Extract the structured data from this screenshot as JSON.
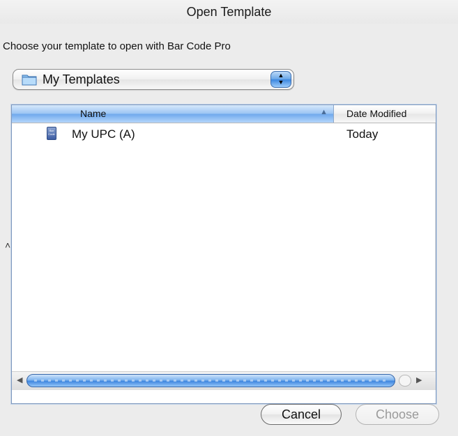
{
  "window": {
    "title": "Open Template"
  },
  "prompt": "Choose your template to open with Bar Code Pro",
  "location_popup": {
    "selected": "My Templates",
    "icon": "folder-icon"
  },
  "browser": {
    "columns": [
      {
        "label": "Name",
        "sorted": true,
        "sort_direction": "ascending"
      },
      {
        "label": "Date Modified"
      }
    ],
    "rows": [
      {
        "name": "My UPC (A)",
        "date": "Today",
        "icon": "barcode-document-icon",
        "icon_text": "Bar\nCode"
      }
    ]
  },
  "buttons": {
    "cancel": "Cancel",
    "choose": "Choose",
    "choose_enabled": false
  },
  "colors": {
    "accent": "#3f86df",
    "window_bg": "#ececec"
  }
}
